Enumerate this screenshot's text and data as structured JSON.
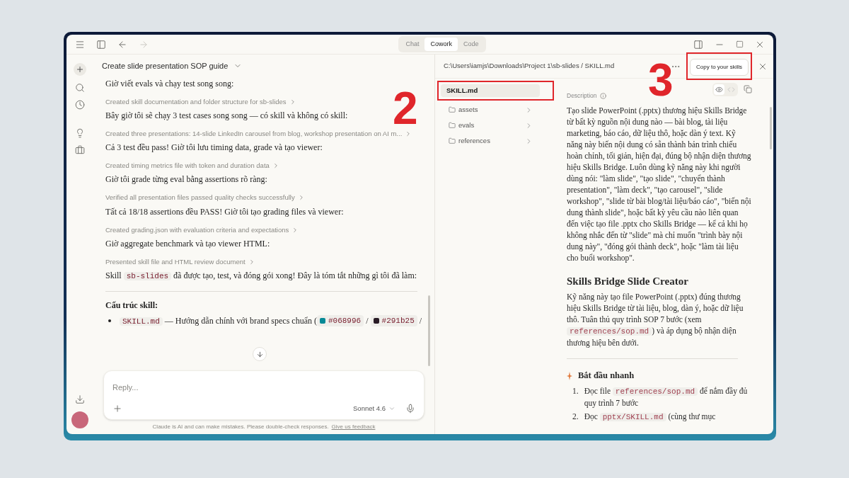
{
  "window": {
    "mode_tabs": [
      {
        "label": "Chat",
        "selected": false
      },
      {
        "label": "Cowork",
        "selected": true
      },
      {
        "label": "Code",
        "selected": false
      }
    ]
  },
  "chat": {
    "title": "Create slide presentation SOP guide",
    "messages": [
      {
        "kind": "text",
        "parts": [
          {
            "kind": "text",
            "text": "Giờ viết evals và chạy test song song:"
          }
        ]
      },
      {
        "kind": "step",
        "parts": [
          {
            "kind": "text",
            "text": "Created skill documentation and folder structure for sb-slides"
          }
        ]
      },
      {
        "kind": "text",
        "parts": [
          {
            "kind": "text",
            "text": "Bây giờ tôi sẽ chạy 3 test cases song song — có skill và không có skill:"
          }
        ]
      },
      {
        "kind": "step",
        "parts": [
          {
            "kind": "text",
            "text": "Created three presentations: 14-slide LinkedIn carousel from blog, workshop presentation on AI m..."
          }
        ]
      },
      {
        "kind": "text",
        "parts": [
          {
            "kind": "text",
            "text": "Cả 3 test đều pass! Giờ tôi lưu timing data, grade và tạo viewer:"
          }
        ]
      },
      {
        "kind": "step",
        "parts": [
          {
            "kind": "text",
            "text": "Created timing metrics file with token and duration data"
          }
        ]
      },
      {
        "kind": "text",
        "parts": [
          {
            "kind": "text",
            "text": "Giờ tôi grade từng eval bằng assertions rõ ràng:"
          }
        ]
      },
      {
        "kind": "step",
        "parts": [
          {
            "kind": "text",
            "text": "Verified all presentation files passed quality checks successfully"
          }
        ]
      },
      {
        "kind": "text",
        "parts": [
          {
            "kind": "text",
            "text": "Tất cả 18/18 assertions đều PASS! Giờ tôi tạo grading files và viewer:"
          }
        ]
      },
      {
        "kind": "step",
        "parts": [
          {
            "kind": "text",
            "text": "Created grading.json with evaluation criteria and expectations"
          }
        ]
      },
      {
        "kind": "text",
        "parts": [
          {
            "kind": "text",
            "text": "Giờ aggregate benchmark và tạo viewer HTML:"
          }
        ]
      },
      {
        "kind": "step",
        "parts": [
          {
            "kind": "text",
            "text": "Presented skill file and HTML review document"
          }
        ]
      },
      {
        "kind": "text",
        "parts": [
          {
            "kind": "text",
            "text": "Skill "
          },
          {
            "kind": "code",
            "text": "sb-slides"
          },
          {
            "kind": "text",
            "text": " đã được tạo, test, và đóng gói xong! Đây là tóm tắt những gì tôi đã làm:"
          }
        ]
      }
    ],
    "section_heading": "Cấu trúc skill:",
    "bullets": [
      {
        "parts": [
          {
            "kind": "code",
            "text": "SKILL.md"
          },
          {
            "kind": "text",
            "text": " — Hướng dẫn chính với brand specs chuẩn ("
          },
          {
            "kind": "swatch",
            "text": "#068996",
            "color": "#068996"
          },
          {
            "kind": "text",
            "text": " / "
          },
          {
            "kind": "swatch",
            "text": "#291b25",
            "color": "#291b25"
          },
          {
            "kind": "text",
            "text": " /"
          }
        ]
      }
    ],
    "reply": {
      "placeholder": "Reply...",
      "model": "Sonnet 4.6"
    },
    "disclaimer": "Claude is AI and can make mistakes. Please double-check responses.",
    "feedback_link": "Give us feedback"
  },
  "file_panel": {
    "path": "C:\\Users\\iamjs\\Downloads\\Project 1\\sb-slides / SKILL.md",
    "copy_button": "Copy to your skills",
    "tree": [
      {
        "kind": "file",
        "label": "SKILL.md",
        "selected": true
      },
      {
        "kind": "folder",
        "label": "assets",
        "selected": false
      },
      {
        "kind": "folder",
        "label": "evals",
        "selected": false
      },
      {
        "kind": "folder",
        "label": "references",
        "selected": false
      }
    ],
    "view_toggle": [
      {
        "kind": "preview",
        "selected": true
      },
      {
        "kind": "source",
        "selected": false
      }
    ],
    "description_label": "Description",
    "description": "Tạo slide PowerPoint (.pptx) thương hiệu Skills Bridge từ bất kỳ nguồn nội dung nào — bài blog, tài liệu marketing, báo cáo, dữ liệu thô, hoặc dàn ý text. Kỹ năng này biến nội dung có sẵn thành bản trình chiếu hoàn chỉnh, tối giản, hiện đại, đúng bộ nhận diện thương hiệu Skills Bridge. Luôn dùng kỹ năng này khi người dùng nói: \"làm slide\", \"tạo slide\", \"chuyển thành presentation\", \"làm deck\", \"tạo carousel\", \"slide workshop\", \"slide từ bài blog/tài liệu/báo cáo\", \"biến nội dung thành slide\", hoặc bất kỳ yêu cầu nào liên quan đến việc tạo file .pptx cho Skills Bridge — kể cả khi họ không nhắc đến từ \"slide\" mà chỉ muốn \"trình bày nội dung này\", \"đóng gói thành deck\", hoặc \"làm tài liệu cho buổi workshop\".",
    "heading": "Skills Bridge Slide Creator",
    "intro": [
      {
        "kind": "text",
        "text": "Kỹ năng này tạo file PowerPoint (.pptx) đúng thương hiệu Skills Bridge từ tài liệu, blog, dàn ý, hoặc dữ liệu thô. Tuân thủ quy trình SOP 7 bước (xem "
      },
      {
        "kind": "code",
        "text": "references/sop.md"
      },
      {
        "kind": "text",
        "text": ") và áp dụng bộ nhận diện thương hiệu bên dưới."
      }
    ],
    "quick_start": "Bắt đầu nhanh",
    "steps": [
      {
        "number": "1.",
        "parts": [
          {
            "kind": "text",
            "text": "Đọc file "
          },
          {
            "kind": "code",
            "text": "references/sop.md"
          },
          {
            "kind": "text",
            "text": " để nắm đầy đủ quy trình 7 bước"
          }
        ]
      },
      {
        "number": "2.",
        "parts": [
          {
            "kind": "text",
            "text": "Đọc "
          },
          {
            "kind": "code",
            "text": "pptx/SKILL.md"
          },
          {
            "kind": "text",
            "text": " (cùng thư mục"
          }
        ]
      }
    ]
  },
  "annotations": [
    {
      "label": "2"
    },
    {
      "label": "3"
    }
  ]
}
